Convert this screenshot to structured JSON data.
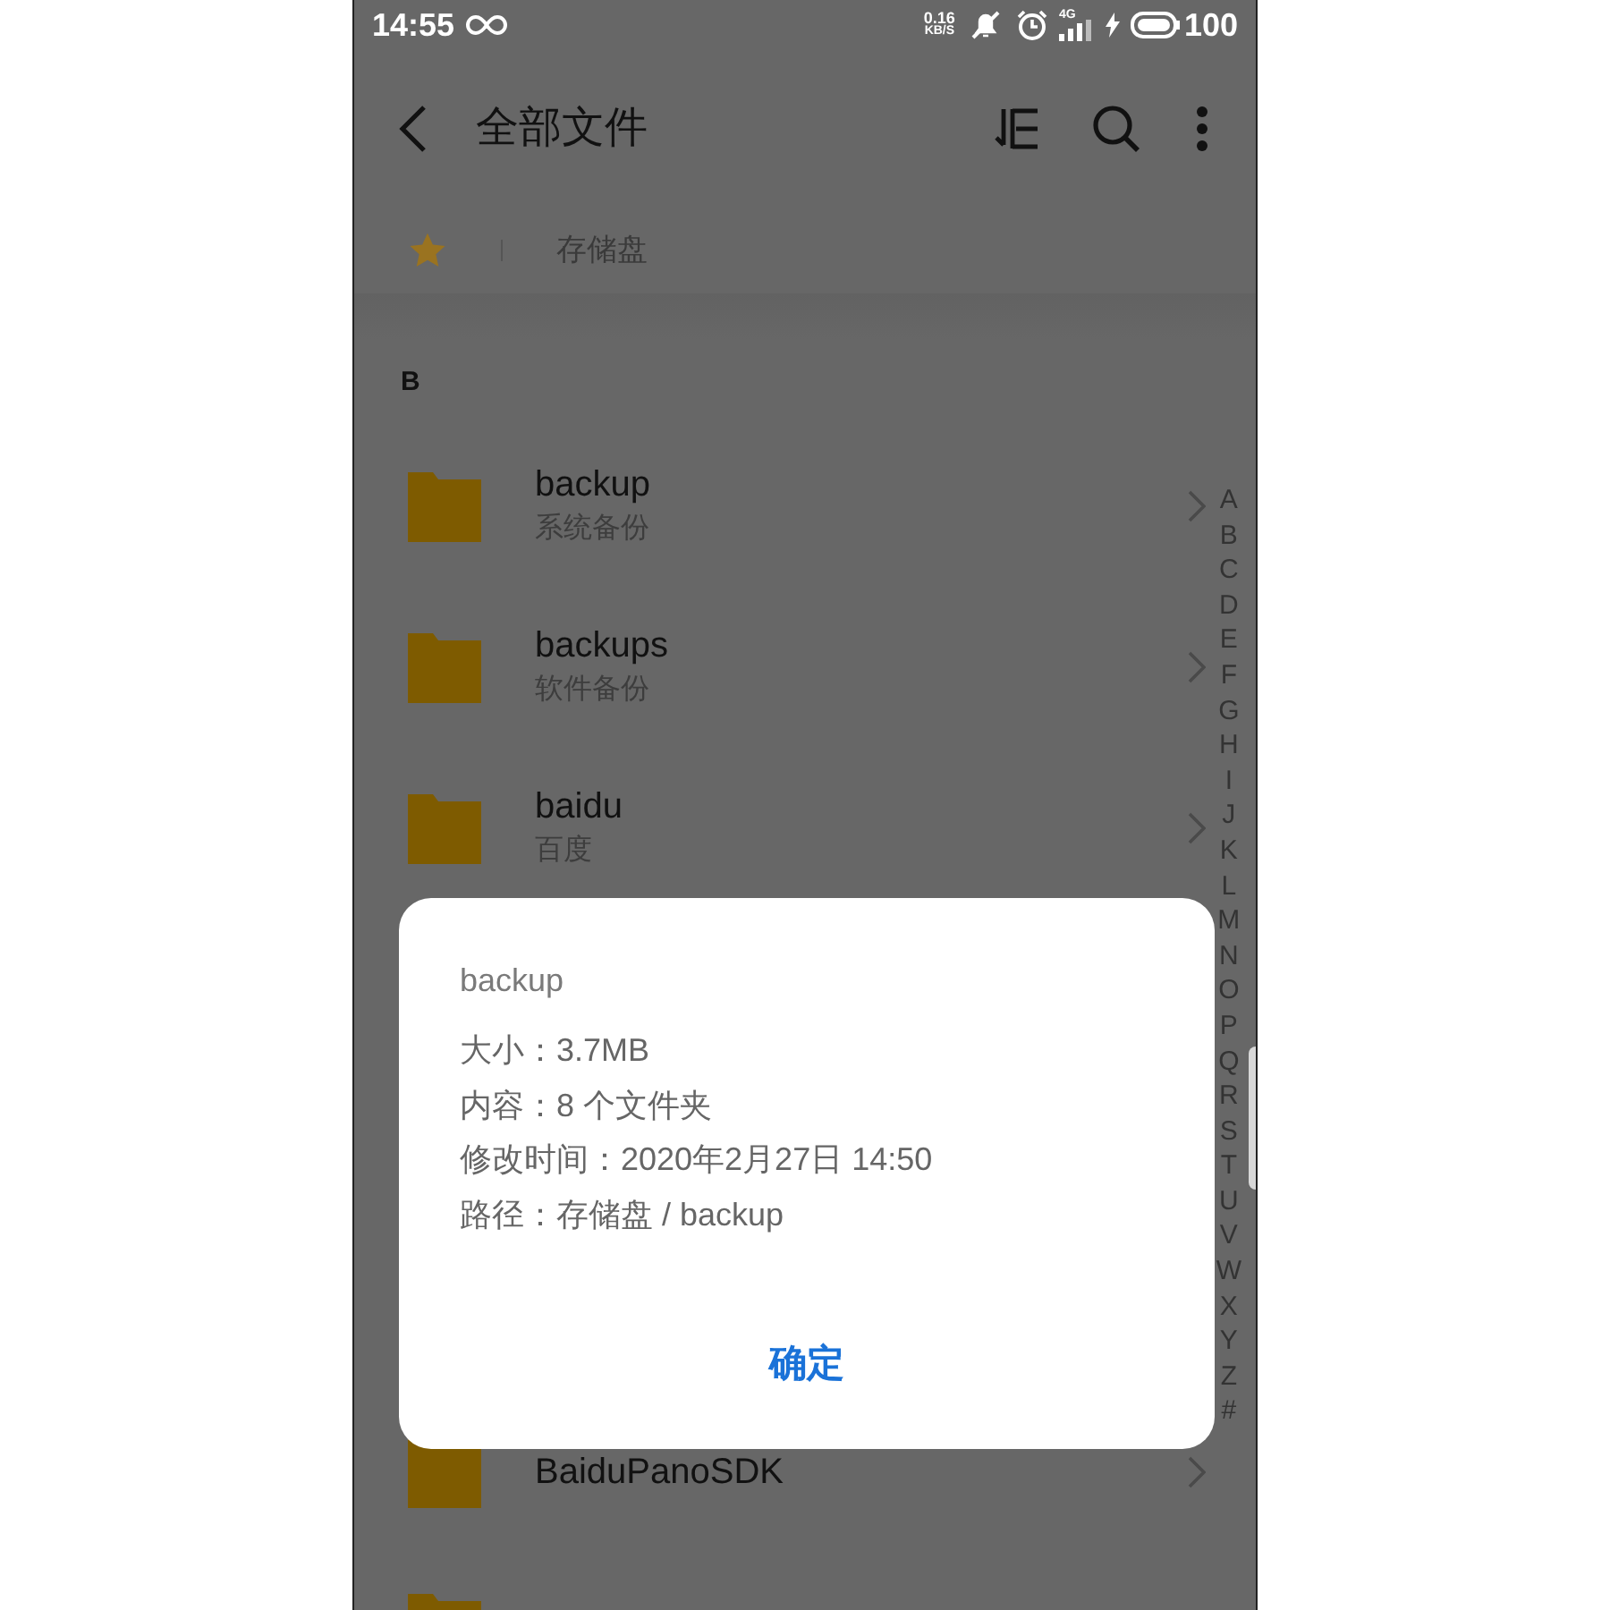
{
  "status_bar": {
    "time": "14:55",
    "net_speed": "0.16",
    "net_unit": "KB/S",
    "network": "4G",
    "battery": "100"
  },
  "header": {
    "title": "全部文件"
  },
  "breadcrumb": {
    "path": "存储盘"
  },
  "section": "B",
  "files": [
    {
      "name": "backup",
      "description": "系统备份"
    },
    {
      "name": "backups",
      "description": "软件备份"
    },
    {
      "name": "baidu",
      "description": "百度"
    },
    {
      "name": "BaiduPanoSDK"
    }
  ],
  "index_letters": [
    "A",
    "B",
    "C",
    "D",
    "E",
    "F",
    "G",
    "H",
    "I",
    "J",
    "K",
    "L",
    "M",
    "N",
    "O",
    "P",
    "Q",
    "R",
    "S",
    "T",
    "U",
    "V",
    "W",
    "X",
    "Y",
    "Z",
    "#"
  ],
  "dialog": {
    "title": "backup",
    "lines": [
      "大小：3.7MB",
      "内容：8 个文件夹",
      "修改时间：2020年2月27日 14:50",
      "路径：存储盘 / backup"
    ],
    "confirm": "确定"
  }
}
